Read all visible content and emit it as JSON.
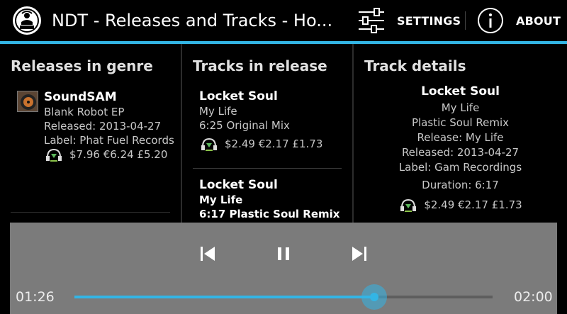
{
  "app": {
    "title": "NDT - Releases and Tracks - Ho...",
    "logo_icon": "dj-logo-icon",
    "accent_color": "#33b5e5"
  },
  "actionbar": {
    "settings_label": "SETTINGS",
    "settings_icon": "sliders-icon",
    "about_label": "ABOUT",
    "about_icon": "info-icon"
  },
  "releases_panel": {
    "title": "Releases in genre",
    "items": [
      {
        "artist": "SoundSAM",
        "name": "Blank Robot EP",
        "released": "Released: 2013-04-27",
        "label": "Label: Phat Fuel Records",
        "price": "$7.96 €6.24 £5.20"
      }
    ]
  },
  "tracks_panel": {
    "title": "Tracks in release",
    "items": [
      {
        "artist": "Locket Soul",
        "release": "My Life",
        "mix": "6:25 Original Mix",
        "price": "$2.49 €2.17 £1.73"
      },
      {
        "artist": "Locket Soul",
        "release": "My Life",
        "mix": "6:17 Plastic Soul Remix"
      }
    ]
  },
  "details_panel": {
    "title": "Track details",
    "artist": "Locket Soul",
    "release": "My Life",
    "mix": "Plastic Soul Remix",
    "release_line": "Release: My Life",
    "released": "Released: 2013-04-27",
    "label": "Label: Gam Recordings",
    "duration": "Duration: 6:17",
    "price": "$2.49 €2.17 £1.73"
  },
  "player": {
    "elapsed": "01:26",
    "total": "02:00",
    "progress": 0.717,
    "prev_icon": "skip-previous-icon",
    "pause_icon": "pause-icon",
    "next_icon": "skip-next-icon"
  }
}
